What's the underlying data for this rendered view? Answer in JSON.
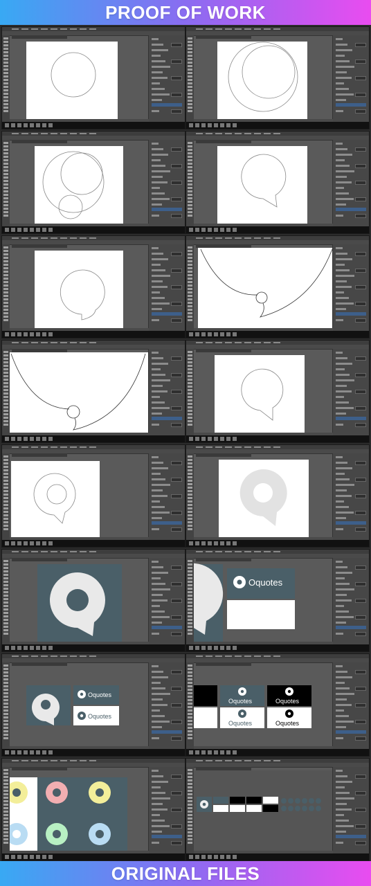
{
  "header": {
    "title": "PROOF OF WORK"
  },
  "footer": {
    "title": "ORIGINAL FILES"
  },
  "logo_text": "Oquotes",
  "colors": {
    "slate": "#4a5f68",
    "selection": "#3d5f8a",
    "pink": "#f2aeb1",
    "yellow": "#f3ee9a",
    "blue": "#b9dcf3",
    "green": "#b8f0c3"
  },
  "screenshots": [
    {
      "name": "step-1-circle"
    },
    {
      "name": "step-2-overlapping-circles"
    },
    {
      "name": "step-3-three-circles"
    },
    {
      "name": "step-4-speech-bubble-outline"
    },
    {
      "name": "step-5-bubble-tail"
    },
    {
      "name": "step-6-large-curve"
    },
    {
      "name": "step-7-large-curve-zoomed"
    },
    {
      "name": "step-8-bubble-refined"
    },
    {
      "name": "step-9-inner-circle"
    },
    {
      "name": "step-10-grey-fill"
    },
    {
      "name": "step-11-slate-background"
    },
    {
      "name": "step-12-logo-with-text"
    },
    {
      "name": "step-13-logo-variations"
    },
    {
      "name": "step-14-black-white-versions"
    },
    {
      "name": "step-15-colour-versions"
    },
    {
      "name": "step-16-final-sheet"
    }
  ]
}
